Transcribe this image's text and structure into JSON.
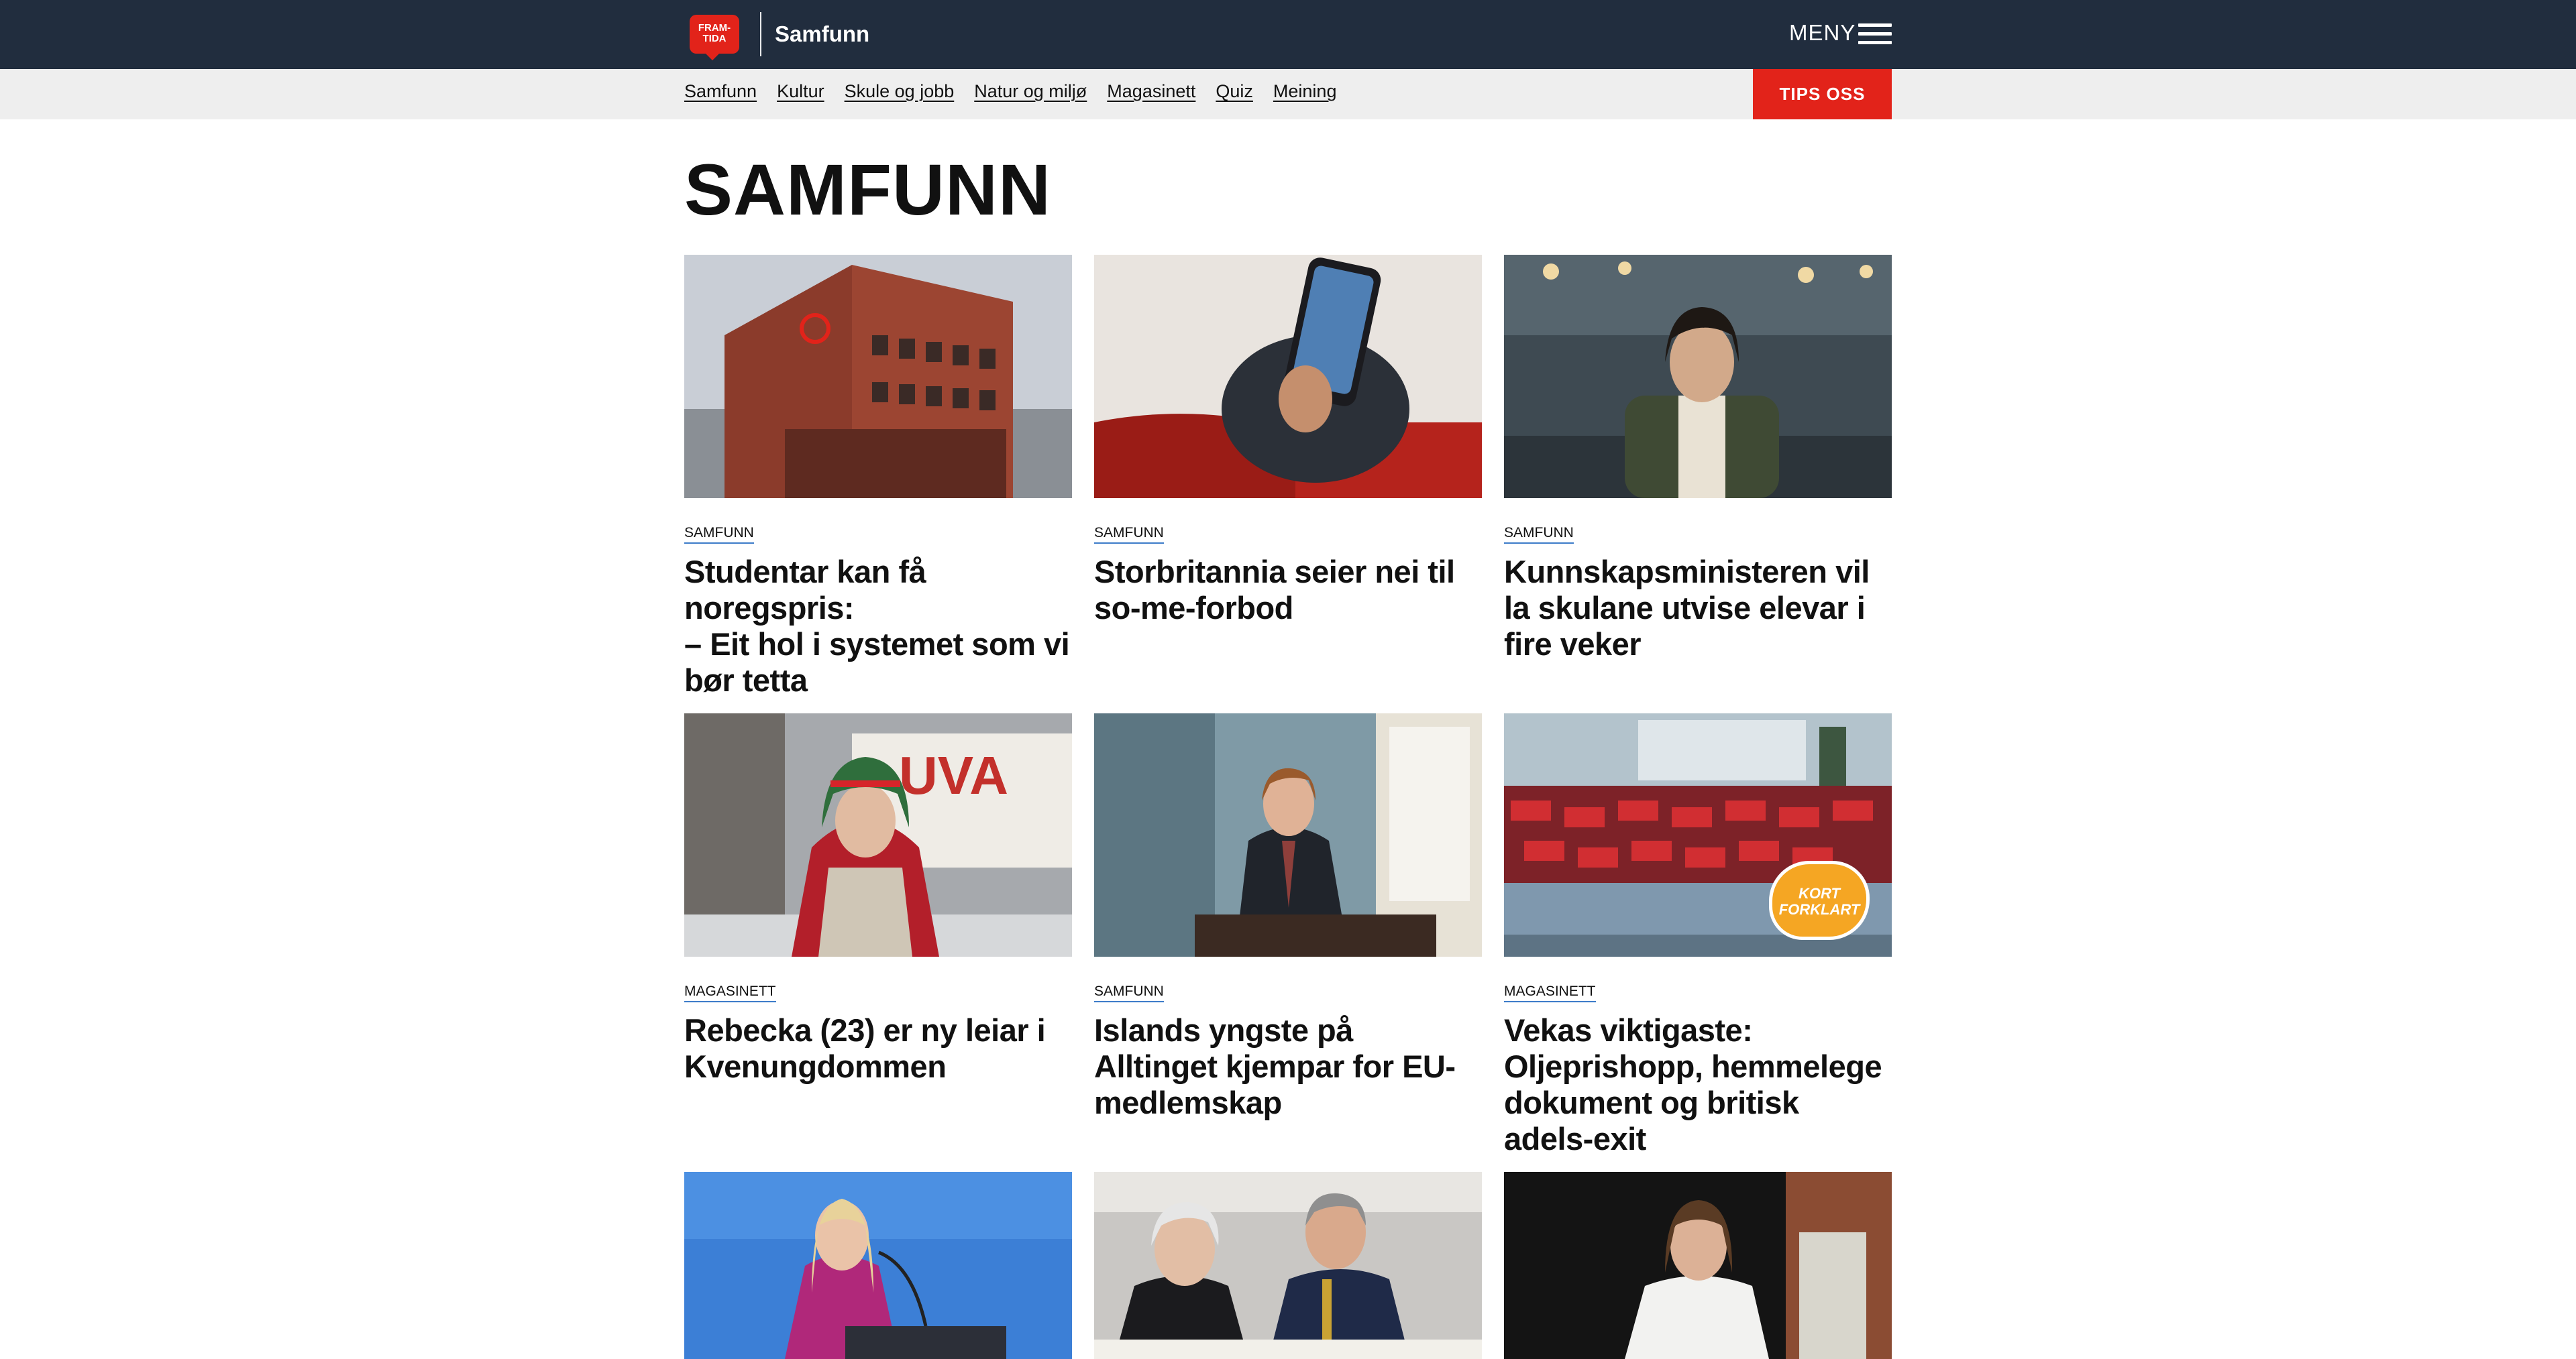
{
  "header": {
    "logo_text": "FRAM-TIDA",
    "section": "Samfunn",
    "menu_label": "MENY"
  },
  "subnav": {
    "items": [
      "Samfunn",
      "Kultur",
      "Skule og jobb",
      "Natur og miljø",
      "Magasinett",
      "Quiz",
      "Meining"
    ],
    "tips_button": "TIPS OSS"
  },
  "page": {
    "title": "SAMFUNN"
  },
  "articles": [
    {
      "kicker": "SAMFUNN",
      "headline": "Studentar kan få noregspris:\n– Eit hol i systemet som vi bør tetta",
      "image": "brick-building-photo"
    },
    {
      "kicker": "SAMFUNN",
      "headline": "Storbritannia seier nei til so-me-forbod",
      "image": "phone-in-hand-photo"
    },
    {
      "kicker": "SAMFUNN",
      "headline": "Kunnskapsministeren vil la skulane utvise elevar i fire veker",
      "image": "minister-portrait-photo"
    },
    {
      "kicker": "MAGASINETT",
      "headline": "Rebecka (23) er ny leiar i Kvenungdommen",
      "image": "woman-in-headscarf-photo"
    },
    {
      "kicker": "SAMFUNN",
      "headline": "Islands yngste på Alltinget kjempar for EU-medlemskap",
      "image": "man-at-podium-photo"
    },
    {
      "kicker": "MAGASINETT",
      "headline": "Vekas viktigaste: Oljeprishopp, hemmelege dokument og britisk adels-exit",
      "image": "news-collage-photo",
      "badge": "KORT FORKLART"
    },
    {
      "kicker": "",
      "headline": "",
      "image": "speaker-at-podium-photo"
    },
    {
      "kicker": "",
      "headline": "",
      "image": "court-hearing-photo"
    },
    {
      "kicker": "",
      "headline": "",
      "image": "woman-portrait-photo"
    }
  ]
}
